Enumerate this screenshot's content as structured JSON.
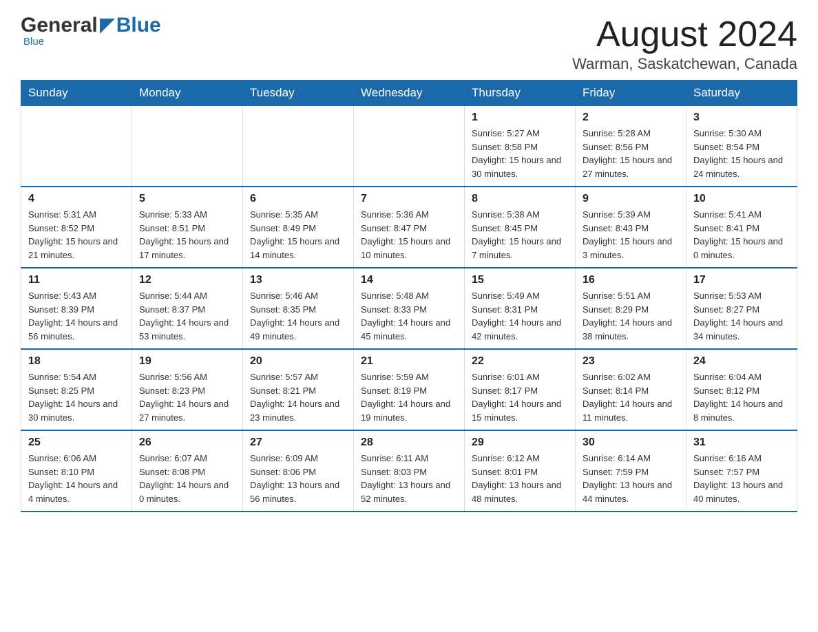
{
  "header": {
    "logo_general": "General",
    "logo_blue": "Blue",
    "logo_tagline": "Blue",
    "title": "August 2024",
    "subtitle": "Warman, Saskatchewan, Canada"
  },
  "calendar": {
    "days_of_week": [
      "Sunday",
      "Monday",
      "Tuesday",
      "Wednesday",
      "Thursday",
      "Friday",
      "Saturday"
    ],
    "weeks": [
      [
        {
          "day": "",
          "info": ""
        },
        {
          "day": "",
          "info": ""
        },
        {
          "day": "",
          "info": ""
        },
        {
          "day": "",
          "info": ""
        },
        {
          "day": "1",
          "info": "Sunrise: 5:27 AM\nSunset: 8:58 PM\nDaylight: 15 hours and 30 minutes."
        },
        {
          "day": "2",
          "info": "Sunrise: 5:28 AM\nSunset: 8:56 PM\nDaylight: 15 hours and 27 minutes."
        },
        {
          "day": "3",
          "info": "Sunrise: 5:30 AM\nSunset: 8:54 PM\nDaylight: 15 hours and 24 minutes."
        }
      ],
      [
        {
          "day": "4",
          "info": "Sunrise: 5:31 AM\nSunset: 8:52 PM\nDaylight: 15 hours and 21 minutes."
        },
        {
          "day": "5",
          "info": "Sunrise: 5:33 AM\nSunset: 8:51 PM\nDaylight: 15 hours and 17 minutes."
        },
        {
          "day": "6",
          "info": "Sunrise: 5:35 AM\nSunset: 8:49 PM\nDaylight: 15 hours and 14 minutes."
        },
        {
          "day": "7",
          "info": "Sunrise: 5:36 AM\nSunset: 8:47 PM\nDaylight: 15 hours and 10 minutes."
        },
        {
          "day": "8",
          "info": "Sunrise: 5:38 AM\nSunset: 8:45 PM\nDaylight: 15 hours and 7 minutes."
        },
        {
          "day": "9",
          "info": "Sunrise: 5:39 AM\nSunset: 8:43 PM\nDaylight: 15 hours and 3 minutes."
        },
        {
          "day": "10",
          "info": "Sunrise: 5:41 AM\nSunset: 8:41 PM\nDaylight: 15 hours and 0 minutes."
        }
      ],
      [
        {
          "day": "11",
          "info": "Sunrise: 5:43 AM\nSunset: 8:39 PM\nDaylight: 14 hours and 56 minutes."
        },
        {
          "day": "12",
          "info": "Sunrise: 5:44 AM\nSunset: 8:37 PM\nDaylight: 14 hours and 53 minutes."
        },
        {
          "day": "13",
          "info": "Sunrise: 5:46 AM\nSunset: 8:35 PM\nDaylight: 14 hours and 49 minutes."
        },
        {
          "day": "14",
          "info": "Sunrise: 5:48 AM\nSunset: 8:33 PM\nDaylight: 14 hours and 45 minutes."
        },
        {
          "day": "15",
          "info": "Sunrise: 5:49 AM\nSunset: 8:31 PM\nDaylight: 14 hours and 42 minutes."
        },
        {
          "day": "16",
          "info": "Sunrise: 5:51 AM\nSunset: 8:29 PM\nDaylight: 14 hours and 38 minutes."
        },
        {
          "day": "17",
          "info": "Sunrise: 5:53 AM\nSunset: 8:27 PM\nDaylight: 14 hours and 34 minutes."
        }
      ],
      [
        {
          "day": "18",
          "info": "Sunrise: 5:54 AM\nSunset: 8:25 PM\nDaylight: 14 hours and 30 minutes."
        },
        {
          "day": "19",
          "info": "Sunrise: 5:56 AM\nSunset: 8:23 PM\nDaylight: 14 hours and 27 minutes."
        },
        {
          "day": "20",
          "info": "Sunrise: 5:57 AM\nSunset: 8:21 PM\nDaylight: 14 hours and 23 minutes."
        },
        {
          "day": "21",
          "info": "Sunrise: 5:59 AM\nSunset: 8:19 PM\nDaylight: 14 hours and 19 minutes."
        },
        {
          "day": "22",
          "info": "Sunrise: 6:01 AM\nSunset: 8:17 PM\nDaylight: 14 hours and 15 minutes."
        },
        {
          "day": "23",
          "info": "Sunrise: 6:02 AM\nSunset: 8:14 PM\nDaylight: 14 hours and 11 minutes."
        },
        {
          "day": "24",
          "info": "Sunrise: 6:04 AM\nSunset: 8:12 PM\nDaylight: 14 hours and 8 minutes."
        }
      ],
      [
        {
          "day": "25",
          "info": "Sunrise: 6:06 AM\nSunset: 8:10 PM\nDaylight: 14 hours and 4 minutes."
        },
        {
          "day": "26",
          "info": "Sunrise: 6:07 AM\nSunset: 8:08 PM\nDaylight: 14 hours and 0 minutes."
        },
        {
          "day": "27",
          "info": "Sunrise: 6:09 AM\nSunset: 8:06 PM\nDaylight: 13 hours and 56 minutes."
        },
        {
          "day": "28",
          "info": "Sunrise: 6:11 AM\nSunset: 8:03 PM\nDaylight: 13 hours and 52 minutes."
        },
        {
          "day": "29",
          "info": "Sunrise: 6:12 AM\nSunset: 8:01 PM\nDaylight: 13 hours and 48 minutes."
        },
        {
          "day": "30",
          "info": "Sunrise: 6:14 AM\nSunset: 7:59 PM\nDaylight: 13 hours and 44 minutes."
        },
        {
          "day": "31",
          "info": "Sunrise: 6:16 AM\nSunset: 7:57 PM\nDaylight: 13 hours and 40 minutes."
        }
      ]
    ]
  }
}
